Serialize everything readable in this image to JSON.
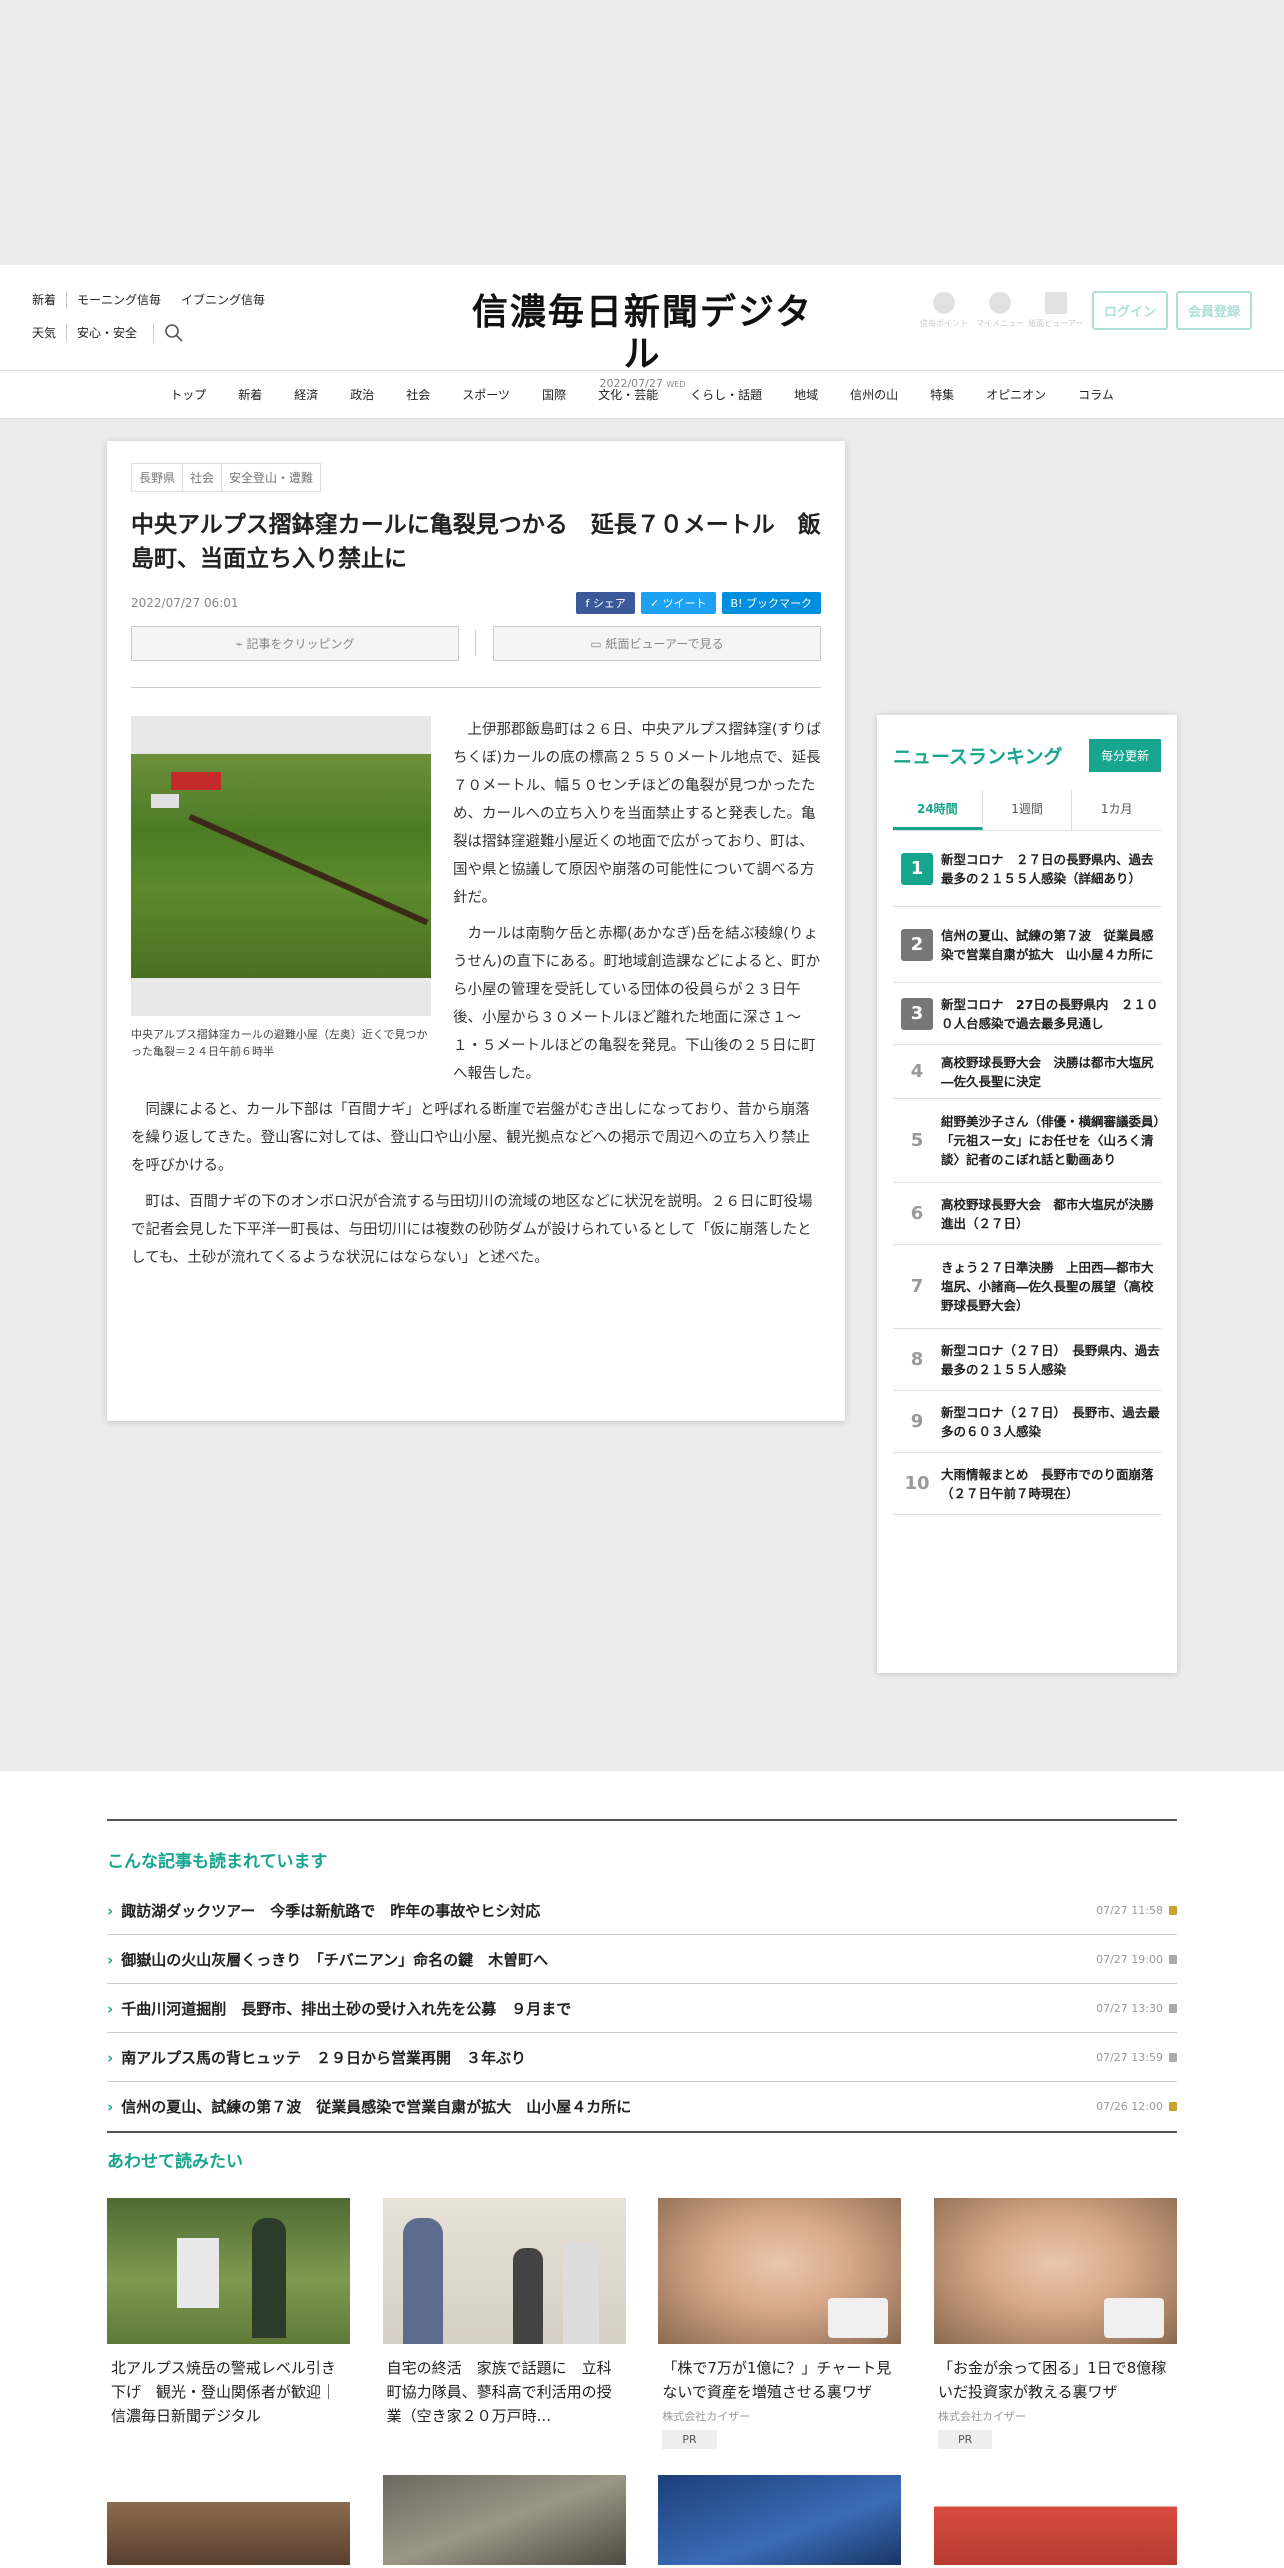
{
  "header": {
    "links_row1": [
      "新着",
      "モーニング信毎",
      "イブニング信毎"
    ],
    "links_row2": [
      "天気",
      "安心・安全"
    ],
    "logo": "信濃毎日新聞デジタル",
    "date": "2022/07/27",
    "weekday": "WED",
    "mini_icons": [
      "信毎ポイント",
      "マイメニュー",
      "紙面ビューアー"
    ],
    "login": "ログイン",
    "register": "会員登録"
  },
  "nav": [
    "トップ",
    "新着",
    "経済",
    "政治",
    "社会",
    "スポーツ",
    "国際",
    "文化・芸能",
    "くらし・話題",
    "地域",
    "信州の山",
    "特集",
    "オピニオン",
    "コラム"
  ],
  "article": {
    "breadcrumbs": [
      "長野県",
      "社会",
      "安全登山・遭難"
    ],
    "headline": "中央アルプス摺鉢窪カールに亀裂見つかる　延長７０メートル　飯島町、当面立ち入り禁止に",
    "date": "2022/07/27 06:01",
    "share_fb": "シェア",
    "share_tw": "ツイート",
    "share_hb": "ブックマーク",
    "clip": "記事をクリッピング",
    "viewer": "紙面ビューアーで見る",
    "caption": "中央アルプス摺鉢窪カールの避難小屋（左奥）近くで見つかった亀裂＝２４日午前６時半",
    "paragraphs": [
      "上伊那郡飯島町は２６日、中央アルプス摺鉢窪(すりばちくぼ)カールの底の標高２５５０メートル地点で、延長７０メートル、幅５０センチほどの亀裂が見つかったため、カールへの立ち入りを当面禁止すると発表した。亀裂は摺鉢窪避難小屋近くの地面で広がっており、町は、国や県と協議して原因や崩落の可能性について調べる方針だ。",
      "カールは南駒ケ岳と赤椰(あかなぎ)岳を結ぶ稜線(りょうせん)の直下にある。町地域創造課などによると、町から小屋の管理を受託している団体の役員らが２３日午後、小屋から３０メートルほど離れた地面に深さ１～１・５メートルほどの亀裂を発見。下山後の２５日に町へ報告した。",
      "同課によると、カール下部は「百間ナギ」と呼ばれる断崖で岩盤がむき出しになっており、昔から崩落を繰り返してきた。登山客に対しては、登山口や山小屋、観光拠点などへの掲示で周辺への立ち入り禁止を呼びかける。",
      "町は、百間ナギの下のオンボロ沢が合流する与田切川の流域の地区などに状況を説明。２６日に町役場で記者会見した下平洋一町長は、与田切川には複数の砂防ダムが設けられているとして「仮に崩落したとしても、土砂が流れてくるような状況にはならない」と述べた。"
    ]
  },
  "ranking": {
    "title": "ニュースランキング",
    "badge": "毎分更新",
    "tabs": [
      "24時間",
      "1週間",
      "1カ月"
    ],
    "items": [
      {
        "num": "1",
        "text": "新型コロナ　２７日の長野県内、過去最多の２１５５人感染（詳細あり）"
      },
      {
        "num": "2",
        "text": "信州の夏山、試練の第７波　従業員感染で営業自粛が拡大　山小屋４カ所に"
      },
      {
        "num": "3",
        "text": "新型コロナ　27日の長野県内　２１００人台感染で過去最多見通し"
      },
      {
        "num": "4",
        "text": "高校野球長野大会　決勝は都市大塩尻―佐久長聖に決定"
      },
      {
        "num": "5",
        "text": "紺野美沙子さん（俳優・横綱審議委員）　「元祖スー女」にお任せを〈山ろく清談〉記者のこぼれ話と動画あり"
      },
      {
        "num": "6",
        "text": "高校野球長野大会　都市大塩尻が決勝進出（２７日）"
      },
      {
        "num": "7",
        "text": "きょう２７日準決勝　上田西―都市大塩尻、小諸商―佐久長聖の展望（高校野球長野大会）"
      },
      {
        "num": "8",
        "text": "新型コロナ（２７日）　長野県内、過去最多の２１５５人感染"
      },
      {
        "num": "9",
        "text": "新型コロナ（２７日）　長野市、過去最多の６０３人感染"
      },
      {
        "num": "10",
        "text": "大雨情報まとめ　長野市でのり面崩落（２７日午前７時現在）"
      }
    ],
    "colors": {
      "1": "#18a58e",
      "2": "#777777",
      "3": "#777777"
    }
  },
  "also_read": {
    "title": "こんな記事も読まれています",
    "items": [
      {
        "title": "諏訪湖ダックツアー　今季は新航路で　昨年の事故やヒシ対応",
        "date": "07/27 11:58",
        "locked": true
      },
      {
        "title": "御嶽山の火山灰層くっきり　「チバニアン」命名の鍵　木曽町へ",
        "date": "07/27 19:00",
        "locked": false
      },
      {
        "title": "千曲川河道掘削　長野市、排出土砂の受け入れ先を公募　９月まで",
        "date": "07/27 13:30",
        "locked": false
      },
      {
        "title": "南アルプス馬の背ヒュッテ　２９日から営業再開　３年ぶり",
        "date": "07/27 13:59",
        "locked": false
      },
      {
        "title": "信州の夏山、試練の第７波　従業員感染で営業自粛が拡大　山小屋４カ所に",
        "date": "07/26 12:00",
        "locked": true
      }
    ]
  },
  "recommend": {
    "title": "あわせて読みたい",
    "cards": [
      {
        "title": "北アルプス焼岳の警戒レベル引き下げ　観光・登山関係者が歓迎｜信濃毎日新聞デジタル",
        "sponsor": "",
        "pr": ""
      },
      {
        "title": "自宅の終活　家族で話題に　立科町協力隊員、蓼科高で利活用の授業（空き家２０万戸時...",
        "sponsor": "",
        "pr": ""
      },
      {
        "title": "「株で7万が1億に？」チャート見ないで資産を増殖させる裏ワザ",
        "sponsor": "株式会社カイザー",
        "pr": "PR"
      },
      {
        "title": "「お金が余って困る」1日で8億稼いだ投資家が教える裏ワザ",
        "sponsor": "株式会社カイザー",
        "pr": "PR"
      }
    ]
  }
}
